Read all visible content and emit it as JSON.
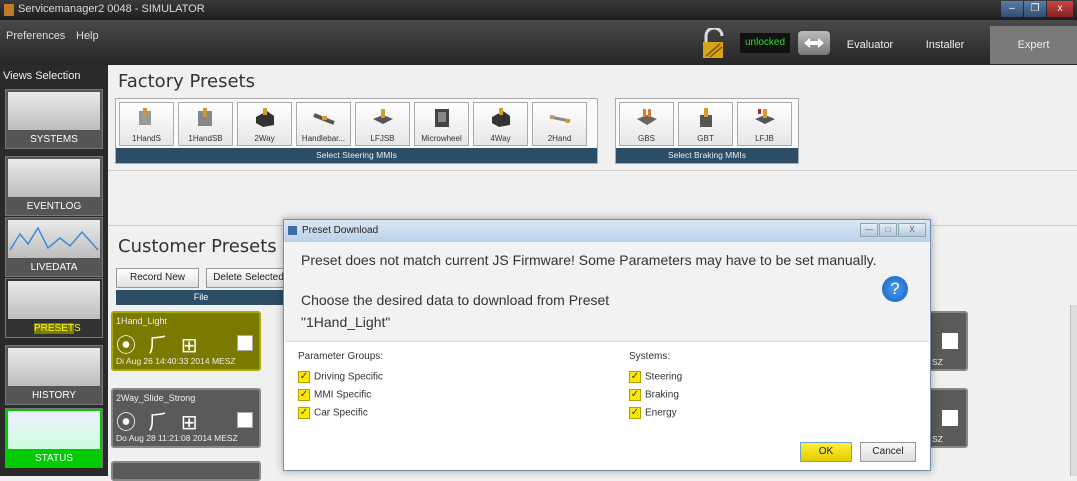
{
  "window": {
    "title": "Servicemanager2 0048 - SIMULATOR",
    "controls": [
      "–",
      "❐",
      "x"
    ]
  },
  "menu": {
    "preferences": "Preferences",
    "help": "Help"
  },
  "lock": {
    "status": "unlocked",
    "status_color": "#2ce02c"
  },
  "roles": {
    "evaluator": "Evaluator",
    "installer": "Installer",
    "expert": "Expert",
    "active": "Expert"
  },
  "sidebar": {
    "header": "Views Selection",
    "items": [
      {
        "label": "SYSTEMS"
      },
      {
        "label": "EVENTLOG"
      },
      {
        "label": "LIVEDATA"
      },
      {
        "label": "PRESETS"
      },
      {
        "label": "HISTORY"
      },
      {
        "label": "STATUS"
      }
    ]
  },
  "factory": {
    "title": "Factory Presets",
    "steering": {
      "footer": "Select Steering MMIs",
      "items": [
        "1HandS",
        "1HandSB",
        "2Way",
        "Handlebar...",
        "LFJSB",
        "Microwheel",
        "4Way",
        "2Hand"
      ]
    },
    "braking": {
      "footer": "Select Braking MMIs",
      "items": [
        "GBS",
        "GBT",
        "LFJB"
      ]
    }
  },
  "customer": {
    "title": "Customer Presets",
    "record_new": "Record New",
    "delete_selected": "Delete Selected",
    "file_header": "File",
    "cards": [
      {
        "name": "1Hand_Light",
        "date": "Di Aug 26 14:40:33 2014 MESZ",
        "icons": "⦿ ⺁ ⊞"
      },
      {
        "name": "2Way_Slide_Strong",
        "date": "Do Aug 28 11:21:08 2014 MESZ",
        "icons": "⦿ ⺁ ⊞"
      }
    ],
    "right_suffix": "SZ"
  },
  "dialog": {
    "title": "Preset Download",
    "window_controls": [
      "—",
      "□",
      "X"
    ],
    "message1": "Preset does not match current JS Firmware! Some Parameters may have to be set manually.",
    "message2": "Choose the desired data to download from Preset",
    "preset_name": "\"1Hand_Light\"",
    "help": "?",
    "parameter_groups": {
      "header": "Parameter Groups:",
      "items": [
        {
          "label": "Driving Specific",
          "checked": true
        },
        {
          "label": "MMI Specific",
          "checked": true
        },
        {
          "label": "Car Specific",
          "checked": true
        }
      ]
    },
    "systems": {
      "header": "Systems:",
      "items": [
        {
          "label": "Steering",
          "checked": true
        },
        {
          "label": "Braking",
          "checked": true
        },
        {
          "label": "Energy",
          "checked": true
        }
      ]
    },
    "ok": "OK",
    "cancel": "Cancel"
  }
}
